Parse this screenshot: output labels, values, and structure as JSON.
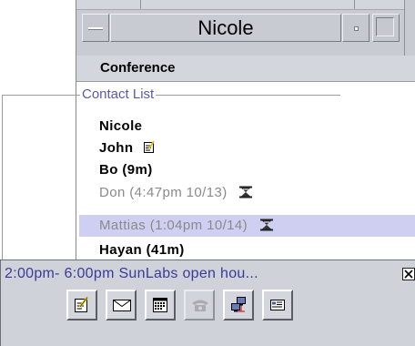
{
  "window": {
    "title": "Nicole"
  },
  "menu": {
    "conference_label": "Conference"
  },
  "contact_list": {
    "legend": "Contact List",
    "contacts": [
      {
        "name": "Nicole",
        "status": "online",
        "icon": ""
      },
      {
        "name": "John",
        "status": "online",
        "icon": "note-icon"
      },
      {
        "name": "Bo (9m)",
        "status": "idle",
        "icon": ""
      },
      {
        "name": "Don (4:47pm 10/13)",
        "status": "away",
        "icon": "hourglass-icon"
      },
      {
        "name": "Mattias (1:04pm 10/14)",
        "status": "away-selected",
        "icon": "hourglass-icon"
      },
      {
        "name": "Hayan (41m)",
        "status": "idle",
        "icon": ""
      }
    ]
  },
  "popup": {
    "event_text": "2:00pm- 6:00pm SunLabs open hou..."
  },
  "toolbar": {
    "buttons": [
      {
        "name": "note-button",
        "icon": "note-pencil-icon",
        "enabled": true
      },
      {
        "name": "mail-button",
        "icon": "envelope-icon",
        "enabled": true
      },
      {
        "name": "calendar-button",
        "icon": "calendar-icon",
        "enabled": true
      },
      {
        "name": "phone-button",
        "icon": "phone-icon",
        "enabled": false
      },
      {
        "name": "share-button",
        "icon": "computers-icon",
        "enabled": true
      },
      {
        "name": "card-button",
        "icon": "business-card-icon",
        "enabled": true
      }
    ]
  },
  "colors": {
    "titlebar": "#c9cbd3",
    "selection": "#cfcff2",
    "legend_text": "#5a5aa8",
    "popup_text": "#3a3a9a",
    "away_text": "#8a8a8a"
  }
}
